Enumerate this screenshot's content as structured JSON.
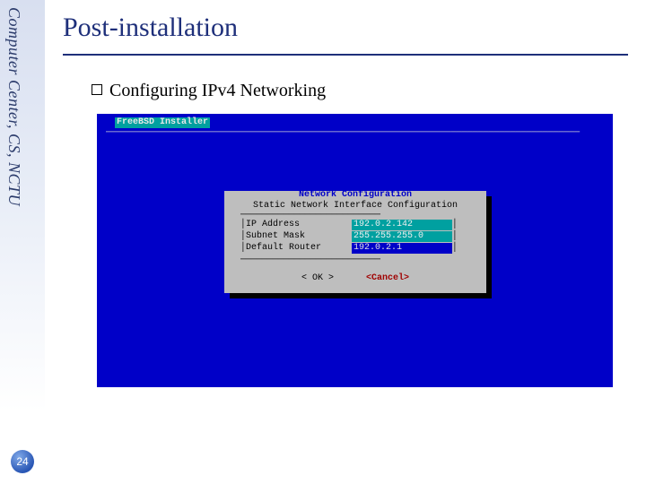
{
  "sidebar": {
    "org": "Computer Center, CS, NCTU"
  },
  "page_number": "24",
  "title": "Post-installation",
  "bullet": "Configuring IPv4 Networking",
  "terminal": {
    "header": "FreeBSD Installer",
    "divider": "────────────────────────────────────────────────────────────────────────────────────────",
    "dialog": {
      "title": "Network Configuration",
      "subtitle": "Static Network Interface Configuration",
      "inner_line": "──────────────────────────",
      "fields": [
        {
          "label": "IP Address",
          "value": "192.0.2.142",
          "selected": false
        },
        {
          "label": "Subnet Mask",
          "value": "255.255.255.0",
          "selected": false
        },
        {
          "label": "Default Router",
          "value": "192.0.2.1",
          "selected": true
        }
      ],
      "buttons": {
        "ok": "OK",
        "cancel": "<Cancel>"
      }
    }
  }
}
